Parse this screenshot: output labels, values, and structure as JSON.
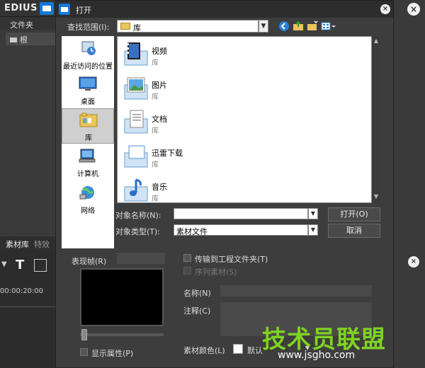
{
  "app": {
    "logo": "EDIUS",
    "left_panel": {
      "header": "文件夹",
      "root_item": "根",
      "tabs": [
        "素材库",
        "特效"
      ]
    },
    "timeline": {
      "time": "00:00:20:00"
    }
  },
  "dialog": {
    "title": "打开",
    "look_in_label": "查找范围(I):",
    "look_in_value": "库",
    "places": [
      {
        "label": "最近访问的位置",
        "icon": "recent-places-icon"
      },
      {
        "label": "桌面",
        "icon": "desktop-icon"
      },
      {
        "label": "库",
        "icon": "libraries-icon",
        "selected": true
      },
      {
        "label": "计算机",
        "icon": "computer-icon"
      },
      {
        "label": "网络",
        "icon": "network-icon"
      }
    ],
    "files": [
      {
        "name": "视频",
        "sub": "库",
        "icon": "videos-icon"
      },
      {
        "name": "图片",
        "sub": "库",
        "icon": "pictures-icon"
      },
      {
        "name": "文档",
        "sub": "库",
        "icon": "documents-icon"
      },
      {
        "name": "迅雷下载",
        "sub": "库",
        "icon": "downloads-icon"
      },
      {
        "name": "音乐",
        "sub": "库",
        "icon": "music-icon"
      }
    ],
    "filename_label": "对象名称(N):",
    "filename_value": "",
    "filetype_label": "对象类型(T):",
    "filetype_value": "素材文件",
    "open_button": "打开(O)",
    "cancel_button": "取消",
    "preview_label": "表现帧(R)",
    "show_props_label": "显示属性(P)",
    "transfer_label": "传输到工程文件夹(T)",
    "sequence_label": "序列素材(S)",
    "name_label": "名称(N)",
    "comment_label": "注释(C)",
    "color_label": "素材颜色(L)",
    "color_value": "默认"
  },
  "watermark": {
    "main": "技术员联盟",
    "url": "www.jsgho.com"
  }
}
